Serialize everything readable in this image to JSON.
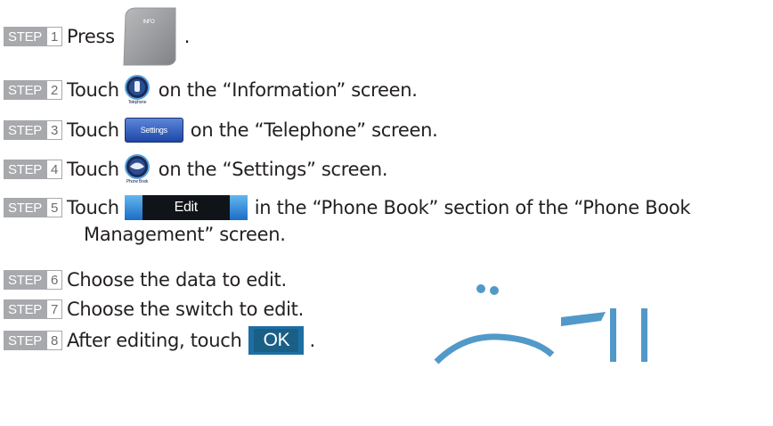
{
  "steps": [
    {
      "label": "STEP",
      "num": "1",
      "before": "Press",
      "after": ".",
      "button": "INFO"
    },
    {
      "label": "STEP",
      "num": "2",
      "before": "Touch",
      "after": "on the “Information” screen.",
      "button": "Telephone"
    },
    {
      "label": "STEP",
      "num": "3",
      "before": "Touch",
      "after": "on the “Telephone” screen.",
      "button": "Settings"
    },
    {
      "label": "STEP",
      "num": "4",
      "before": "Touch",
      "after": "on the “Settings” screen.",
      "button": "Phone Book"
    },
    {
      "label": "STEP",
      "num": "5",
      "before": "Touch",
      "after": "in the “Phone Book” section of the “Phone Book",
      "after2": "Management” screen.",
      "button": "Edit"
    },
    {
      "label": "STEP",
      "num": "6",
      "text": "Choose the data to edit."
    },
    {
      "label": "STEP",
      "num": "7",
      "text": "Choose the switch to edit."
    },
    {
      "label": "STEP",
      "num": "8",
      "before": "After editing, touch",
      "after": ".",
      "button": "OK"
    }
  ],
  "colors": {
    "badge": "#a7a9ac",
    "text": "#231f20",
    "watermark": "#3f8ec4"
  },
  "icons": [
    "info-button-icon",
    "telephone-icon",
    "phone-book-icon"
  ]
}
